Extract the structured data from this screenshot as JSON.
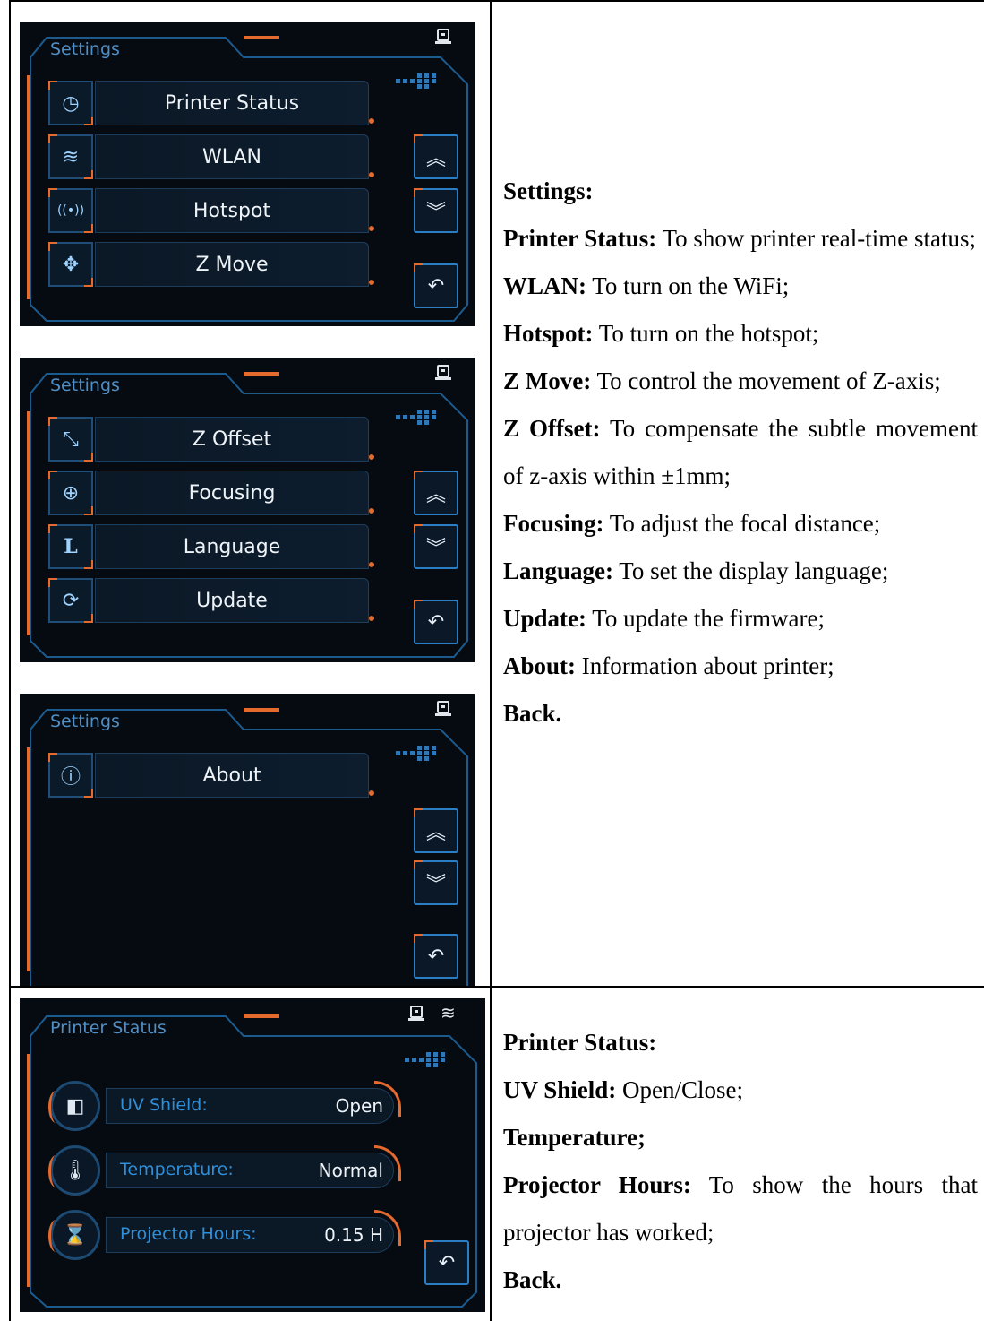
{
  "settings_screens": [
    {
      "title": "Settings",
      "items": [
        {
          "icon": "clock-icon",
          "glyph": "◷",
          "label": "Printer Status"
        },
        {
          "icon": "wifi-icon",
          "glyph": "≋",
          "label": "WLAN"
        },
        {
          "icon": "hotspot-icon",
          "glyph": "((•))",
          "label": "Hotspot"
        },
        {
          "icon": "move-icon",
          "glyph": "✥",
          "label": "Z Move"
        }
      ]
    },
    {
      "title": "Settings",
      "items": [
        {
          "icon": "offset-icon",
          "glyph": "⤡",
          "label": "Z Offset"
        },
        {
          "icon": "crosshair-icon",
          "glyph": "⊕",
          "label": "Focusing"
        },
        {
          "icon": "language-icon",
          "glyph": "L",
          "label": "Language"
        },
        {
          "icon": "refresh-icon",
          "glyph": "⟳",
          "label": "Update"
        }
      ]
    },
    {
      "title": "Settings",
      "items": [
        {
          "icon": "info-icon",
          "glyph": "ⓘ",
          "label": "About"
        }
      ]
    }
  ],
  "status_screen": {
    "title": "Printer Status",
    "rows": [
      {
        "icon": "uv-shield-icon",
        "glyph": "◧",
        "label": "UV Shield:",
        "value": "Open"
      },
      {
        "icon": "thermometer-icon",
        "glyph": "🌡",
        "label": "Temperature:",
        "value": "Normal"
      },
      {
        "icon": "hourglass-icon",
        "glyph": "⌛",
        "label": "Projector Hours:",
        "value": "0.15 H"
      }
    ]
  },
  "buttons": {
    "up": "︽",
    "down": "︾",
    "back": "↶"
  },
  "descriptions": {
    "settings": {
      "heading": "Settings:",
      "entries": [
        {
          "term": "Printer Status:",
          "text": " To show printer real-time status;"
        },
        {
          "term": "WLAN:",
          "text": " To turn on the WiFi;"
        },
        {
          "term": "Hotspot:",
          "text": " To turn on the hotspot;"
        },
        {
          "term": "Z Move:",
          "text": " To control the movement of Z-axis;"
        },
        {
          "term": "Z Offset:",
          "text": " To compensate the subtle movement of z-axis within ±1mm;"
        },
        {
          "term": "Focusing:",
          "text": " To adjust the focal distance;"
        },
        {
          "term": "Language:",
          "text": " To set the display language;"
        },
        {
          "term": "Update:",
          "text": " To update the firmware;"
        },
        {
          "term": "About:",
          "text": " Information about printer;"
        }
      ],
      "back": "Back."
    },
    "status": {
      "heading": "Printer Status:",
      "entries": [
        {
          "term": "UV Shield:",
          "text": " Open/Close;"
        },
        {
          "term": "Temperature;",
          "text": ""
        },
        {
          "term": "Projector Hours:",
          "text": " To show the hours that projector has worked;"
        }
      ],
      "back": "Back."
    }
  }
}
